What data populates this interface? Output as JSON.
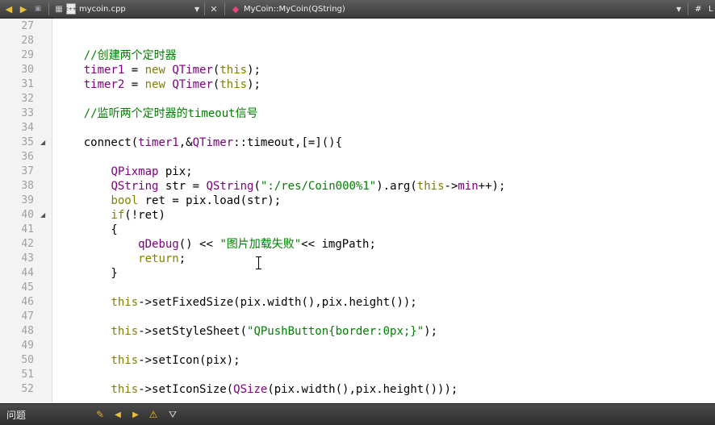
{
  "toolbar": {
    "back_icon": "arrow-left-icon",
    "forward_icon": "arrow-right-icon",
    "file_name": "mycoin.cpp",
    "file_dropdown": "▼",
    "close_glyph": "✕",
    "function_name": "MyCoin::MyCoin(QString)",
    "function_dropdown": "▼",
    "split_label": "#",
    "right_cut_text": "L"
  },
  "editor": {
    "lines": [
      {
        "num": "27",
        "tokens": []
      },
      {
        "num": "28",
        "tokens": []
      },
      {
        "num": "29",
        "tokens": [
          {
            "t": "    //创建两个定时器",
            "c": "cm"
          }
        ]
      },
      {
        "num": "30",
        "tokens": [
          {
            "t": "    timer1",
            "c": "ty"
          },
          {
            "t": " = ",
            "c": "pl"
          },
          {
            "t": "new",
            "c": "kw"
          },
          {
            "t": " ",
            "c": "pl"
          },
          {
            "t": "QTimer",
            "c": "ty"
          },
          {
            "t": "(",
            "c": "pl"
          },
          {
            "t": "this",
            "c": "kw"
          },
          {
            "t": ");",
            "c": "pl"
          }
        ]
      },
      {
        "num": "31",
        "tokens": [
          {
            "t": "    timer2",
            "c": "ty"
          },
          {
            "t": " = ",
            "c": "pl"
          },
          {
            "t": "new",
            "c": "kw"
          },
          {
            "t": " ",
            "c": "pl"
          },
          {
            "t": "QTimer",
            "c": "ty"
          },
          {
            "t": "(",
            "c": "pl"
          },
          {
            "t": "this",
            "c": "kw"
          },
          {
            "t": ");",
            "c": "pl"
          }
        ]
      },
      {
        "num": "32",
        "tokens": []
      },
      {
        "num": "33",
        "tokens": [
          {
            "t": "    //监听两个定时器的timeout信号",
            "c": "cm"
          }
        ]
      },
      {
        "num": "34",
        "tokens": []
      },
      {
        "num": "35",
        "fold": true,
        "tokens": [
          {
            "t": "    connect(",
            "c": "pl"
          },
          {
            "t": "timer1",
            "c": "ty"
          },
          {
            "t": ",&",
            "c": "pl"
          },
          {
            "t": "QTimer",
            "c": "ty"
          },
          {
            "t": "::timeout,[=](){",
            "c": "pl"
          }
        ]
      },
      {
        "num": "36",
        "tokens": []
      },
      {
        "num": "37",
        "tokens": [
          {
            "t": "        ",
            "c": "pl"
          },
          {
            "t": "QPixmap",
            "c": "ty"
          },
          {
            "t": " pix;",
            "c": "pl"
          }
        ]
      },
      {
        "num": "38",
        "tokens": [
          {
            "t": "        ",
            "c": "pl"
          },
          {
            "t": "QString",
            "c": "ty"
          },
          {
            "t": " str = ",
            "c": "pl"
          },
          {
            "t": "QString",
            "c": "ty"
          },
          {
            "t": "(",
            "c": "pl"
          },
          {
            "t": "\":/res/Coin000%1\"",
            "c": "str"
          },
          {
            "t": ").arg(",
            "c": "pl"
          },
          {
            "t": "this",
            "c": "kw"
          },
          {
            "t": "->",
            "c": "pl"
          },
          {
            "t": "min",
            "c": "ty"
          },
          {
            "t": "++);",
            "c": "pl"
          }
        ]
      },
      {
        "num": "39",
        "tokens": [
          {
            "t": "        ",
            "c": "pl"
          },
          {
            "t": "bool",
            "c": "kw"
          },
          {
            "t": " ret = pix.load(str);",
            "c": "pl"
          }
        ]
      },
      {
        "num": "40",
        "fold": true,
        "tokens": [
          {
            "t": "        ",
            "c": "pl"
          },
          {
            "t": "if",
            "c": "kw"
          },
          {
            "t": "(!ret)",
            "c": "pl"
          }
        ]
      },
      {
        "num": "41",
        "tokens": [
          {
            "t": "        {",
            "c": "pl"
          }
        ]
      },
      {
        "num": "42",
        "tokens": [
          {
            "t": "            ",
            "c": "pl"
          },
          {
            "t": "qDebug",
            "c": "ty"
          },
          {
            "t": "() << ",
            "c": "pl"
          },
          {
            "t": "\"图片加载失败\"",
            "c": "str"
          },
          {
            "t": "<< imgPath;",
            "c": "pl"
          }
        ]
      },
      {
        "num": "43",
        "tokens": [
          {
            "t": "            ",
            "c": "pl"
          },
          {
            "t": "return",
            "c": "kw"
          },
          {
            "t": ";",
            "c": "pl"
          }
        ]
      },
      {
        "num": "44",
        "tokens": [
          {
            "t": "        }",
            "c": "pl"
          }
        ]
      },
      {
        "num": "45",
        "tokens": []
      },
      {
        "num": "46",
        "tokens": [
          {
            "t": "        ",
            "c": "pl"
          },
          {
            "t": "this",
            "c": "kw"
          },
          {
            "t": "->setFixedSize(pix.width(),pix.height());",
            "c": "pl"
          }
        ]
      },
      {
        "num": "47",
        "tokens": []
      },
      {
        "num": "48",
        "tokens": [
          {
            "t": "        ",
            "c": "pl"
          },
          {
            "t": "this",
            "c": "kw"
          },
          {
            "t": "->setStyleSheet(",
            "c": "pl"
          },
          {
            "t": "\"QPushButton{border:0px;}\"",
            "c": "str"
          },
          {
            "t": ");",
            "c": "pl"
          }
        ]
      },
      {
        "num": "49",
        "tokens": []
      },
      {
        "num": "50",
        "tokens": [
          {
            "t": "        ",
            "c": "pl"
          },
          {
            "t": "this",
            "c": "kw"
          },
          {
            "t": "->setIcon(pix);",
            "c": "pl"
          }
        ]
      },
      {
        "num": "51",
        "tokens": []
      },
      {
        "num": "52",
        "tokens": [
          {
            "t": "        ",
            "c": "pl"
          },
          {
            "t": "this",
            "c": "kw"
          },
          {
            "t": "->setIconSize(",
            "c": "pl"
          },
          {
            "t": "QSize",
            "c": "ty"
          },
          {
            "t": "(pix.width(),pix.height()));",
            "c": "pl"
          }
        ]
      }
    ]
  },
  "bottombar": {
    "title": "问题",
    "icons": [
      "filter-icon",
      "prev-icon",
      "next-icon",
      "warning-icon",
      "funnel-icon"
    ]
  }
}
